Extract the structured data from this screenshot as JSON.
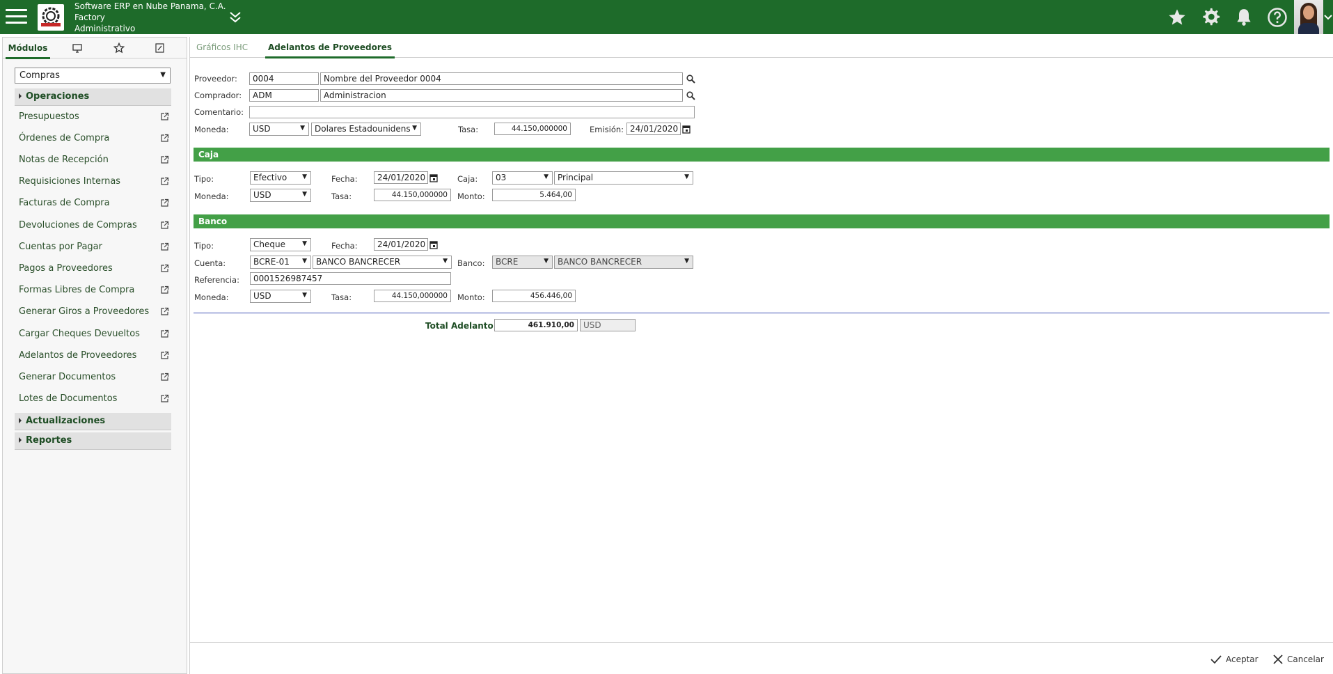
{
  "header": {
    "company_line1": "Software ERP en Nube Panama, C.A.",
    "company_line2": "Factory",
    "company_line3": "Administrativo",
    "brand_color": "#1e6b2a"
  },
  "sidebar": {
    "tabs": [
      "Módulos"
    ],
    "module_select": "Compras",
    "sections": {
      "operaciones": "Operaciones",
      "actualizaciones": "Actualizaciones",
      "reportes": "Reportes"
    },
    "items": [
      "Presupuestos",
      "Órdenes de Compra",
      "Notas de Recepción",
      "Requisiciones Internas",
      "Facturas de Compra",
      "Devoluciones de Compras",
      "Cuentas por Pagar",
      "Pagos a Proveedores",
      "Formas Libres de Compra",
      "Generar Giros a Proveedores",
      "Cargar Cheques Devueltos",
      "Adelantos de Proveedores",
      "Generar Documentos",
      "Lotes de Documentos"
    ]
  },
  "tabs": {
    "graficos": "Gráficos IHC",
    "adelantos": "Adelantos de Proveedores"
  },
  "form": {
    "proveedor_label": "Proveedor:",
    "proveedor_code": "0004",
    "proveedor_name": "Nombre del Proveedor 0004",
    "comprador_label": "Comprador:",
    "comprador_code": "ADM",
    "comprador_name": "Administracion",
    "comentario_label": "Comentario:",
    "comentario_value": "",
    "moneda_label": "Moneda:",
    "moneda_code": "USD",
    "moneda_name": "Dolares Estadounidens",
    "tasa_label": "Tasa:",
    "tasa_value": "44.150,000000",
    "emision_label": "Emisión:",
    "emision_value": "24/01/2020"
  },
  "caja": {
    "title": "Caja",
    "tipo_label": "Tipo:",
    "tipo_value": "Efectivo",
    "fecha_label": "Fecha:",
    "fecha_value": "24/01/2020",
    "caja_label": "Caja:",
    "caja_code": "03",
    "caja_name": "Principal",
    "moneda_label": "Moneda:",
    "moneda_value": "USD",
    "tasa_label": "Tasa:",
    "tasa_value": "44.150,000000",
    "monto_label": "Monto:",
    "monto_value": "5.464,00"
  },
  "banco": {
    "title": "Banco",
    "tipo_label": "Tipo:",
    "tipo_value": "Cheque",
    "fecha_label": "Fecha:",
    "fecha_value": "24/01/2020",
    "cuenta_label": "Cuenta:",
    "cuenta_code": "BCRE-01",
    "cuenta_name": "BANCO BANCRECER",
    "banco_label": "Banco:",
    "banco_code": "BCRE",
    "banco_name": "BANCO BANCRECER",
    "referencia_label": "Referencia:",
    "referencia_value": "0001526987457",
    "moneda_label": "Moneda:",
    "moneda_value": "USD",
    "tasa_label": "Tasa:",
    "tasa_value": "44.150,000000",
    "monto_label": "Monto:",
    "monto_value": "456.446,00"
  },
  "total": {
    "label": "Total Adelanto:",
    "value": "461.910,00",
    "currency": "USD"
  },
  "footer": {
    "aceptar": "Aceptar",
    "cancelar": "Cancelar"
  },
  "colors": {
    "section_bar": "#43a047",
    "separator": "#3f51b5"
  }
}
